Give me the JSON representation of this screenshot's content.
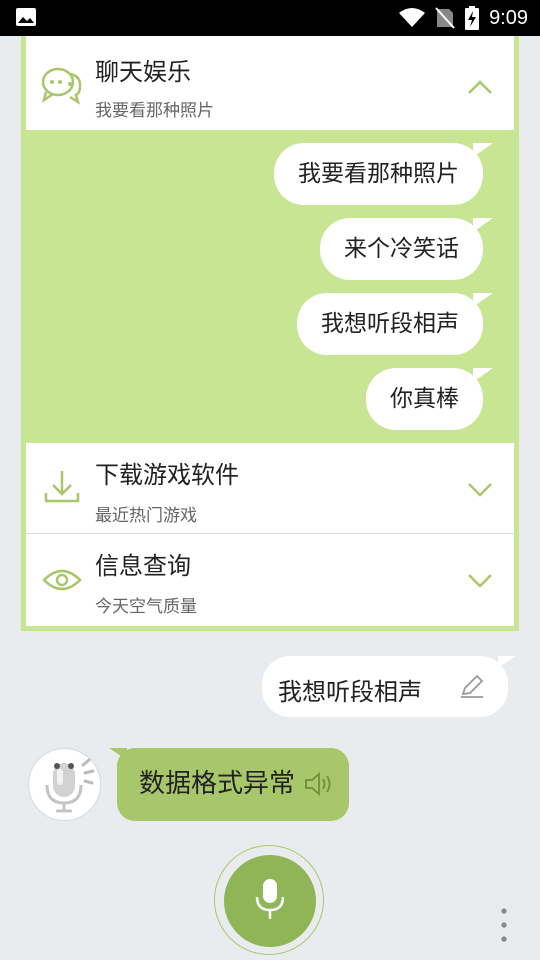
{
  "status_bar": {
    "time": "9:09"
  },
  "sections": [
    {
      "title": "聊天娱乐",
      "subtitle": "我要看那种照片",
      "expanded": true,
      "icon": "chat-icon"
    },
    {
      "title": "下载游戏软件",
      "subtitle": "最近热门游戏",
      "expanded": false,
      "icon": "download-icon"
    },
    {
      "title": "信息查询",
      "subtitle": "今天空气质量",
      "expanded": false,
      "icon": "eye-icon"
    }
  ],
  "suggestions": [
    "我要看那种照片",
    "来个冷笑话",
    "我想听段相声",
    "你真棒"
  ],
  "chat": {
    "user_message": "我想听段相声",
    "bot_message": "数据格式异常"
  },
  "colors": {
    "accent": "#a8c66a",
    "panel_bg": "#c8e594",
    "mic": "#8fb556",
    "background": "#e9ecef"
  }
}
